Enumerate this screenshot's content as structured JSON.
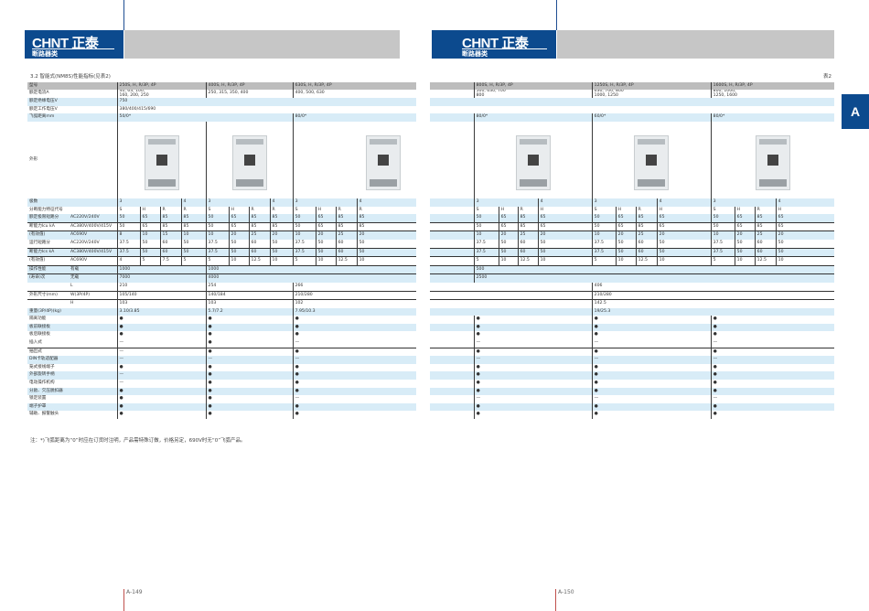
{
  "brand": {
    "logo": "CHNT 正泰",
    "category": "断路器类"
  },
  "section_title": "3.2 智能式(NM8S)性能指标(见表2)",
  "table_no": "表2",
  "side_tab": "A",
  "footnote": "注：*)飞弧距离为“0”时应在订货时注明，产品需特殊订做，价格另定，690V时无“0”飞弧产品。",
  "pages": {
    "left": "A-149",
    "right": "A-150"
  },
  "colors": {
    "brand_blue": "#0c4a8e",
    "row_blue": "#d8ecf7",
    "header_gray": "#bdbdbd"
  },
  "table": {
    "rows": [
      [
        "型号",
        "250S, H, R/3P, 4P",
        "400S, H, R/3P, 4P",
        "630S, H, R/3P, 4P",
        "800S, H, R/3P, 4P",
        "1250S, H, R/3P, 4P",
        "1600S, H, R/3P, 4P"
      ],
      [
        "额定电流A",
        "40, 63, 100,\n160, 200, 250",
        "250, 315, 350, 400",
        "400, 500, 630",
        "500, 630, 700\n800",
        "630, 700, 800\n1000, 1250",
        "800, 1000,\n1250, 1600"
      ],
      [
        "额定绝缘电压V",
        "750"
      ],
      [
        "额定工作电压V",
        "380/400/415/690"
      ],
      [
        "飞弧距离mm",
        "50/0*",
        "80/0*",
        "80/0*",
        "60/0*",
        "80/0*"
      ],
      [
        "外形"
      ],
      [
        "极数",
        "3",
        "4",
        "3",
        "4",
        "3",
        "4",
        "3",
        "4",
        "3",
        "4",
        "3",
        "4"
      ],
      [
        "分断能力特征代号",
        "S",
        "H",
        "R",
        "R",
        "S",
        "H",
        "R",
        "R",
        "S",
        "H",
        "R",
        "R",
        "S",
        "H",
        "R",
        "H",
        "S",
        "H",
        "R",
        "H",
        "S",
        "H",
        "R",
        "H"
      ],
      [
        "额定极限短路分",
        "AC220V/240V",
        "50",
        "65",
        "85",
        "85",
        "50",
        "65",
        "85",
        "85",
        "50",
        "65",
        "85",
        "85",
        "50",
        "65",
        "85",
        "65",
        "50",
        "65",
        "85",
        "65",
        "50",
        "65",
        "85",
        "65"
      ],
      [
        "断能力Icu kA",
        "AC380V/400V/415V",
        "50",
        "65",
        "85",
        "85",
        "50",
        "65",
        "85",
        "85",
        "50",
        "65",
        "85",
        "85",
        "50",
        "65",
        "85",
        "65",
        "50",
        "65",
        "85",
        "65",
        "50",
        "65",
        "85",
        "65"
      ],
      [
        "(有效值)",
        "AC690V",
        "8",
        "10",
        "15",
        "10",
        "10",
        "20",
        "25",
        "20",
        "10",
        "20",
        "25",
        "20",
        "10",
        "20",
        "25",
        "20",
        "10",
        "20",
        "25",
        "20",
        "10",
        "20",
        "25",
        "20"
      ],
      [
        "运行短路分",
        "AC220V/240V",
        "37.5",
        "50",
        "60",
        "50",
        "37.5",
        "50",
        "60",
        "50",
        "37.5",
        "50",
        "60",
        "50",
        "37.5",
        "50",
        "60",
        "50",
        "37.5",
        "50",
        "60",
        "50",
        "37.5",
        "50",
        "60",
        "50"
      ],
      [
        "断能力Ics kA",
        "AC380V/400V/415V",
        "37.5",
        "50",
        "60",
        "50",
        "37.5",
        "50",
        "60",
        "50",
        "37.5",
        "50",
        "60",
        "50",
        "37.5",
        "50",
        "60",
        "50",
        "37.5",
        "50",
        "60",
        "50",
        "37.5",
        "50",
        "60",
        "50"
      ],
      [
        "(有效值)",
        "AC690V",
        "4",
        "5",
        "7.5",
        "5",
        "5",
        "10",
        "12.5",
        "10",
        "5",
        "10",
        "12.5",
        "10",
        "5",
        "10",
        "12.5",
        "10",
        "5",
        "10",
        "12.5",
        "10",
        "5",
        "10",
        "12.5",
        "10"
      ],
      [
        "操作性能",
        "有载",
        "1000",
        "1000",
        "500"
      ],
      [
        "(寿命)次",
        "无载",
        "7000",
        "4000",
        "2500"
      ],
      [
        "",
        "L",
        "210",
        "254",
        "266",
        "406"
      ],
      [
        "外形尺寸(mm)",
        "W(3P/4P)",
        "105/140",
        "140/184",
        "210/280",
        "210/280"
      ],
      [
        "",
        "H",
        "103",
        "103",
        "102",
        "142.5"
      ],
      [
        "重量(3P/4P)(kg)",
        "3.10/3.85",
        "5.7/7.2",
        "7.95/10.3",
        "19/25.3"
      ],
      [
        "隔离功能",
        "●",
        "●",
        "●",
        "●",
        "●",
        "●"
      ],
      [
        "板前联接板",
        "●",
        "●",
        "●",
        "●",
        "●",
        "●"
      ],
      [
        "板后联接板",
        "●",
        "●",
        "●",
        "●",
        "●",
        "●"
      ],
      [
        "插入式",
        "—",
        "●",
        "—",
        "—",
        "—",
        "—"
      ],
      [
        "抽出式",
        "—",
        "●",
        "●",
        "●",
        "●",
        "●"
      ],
      [
        "DIN卡轨适配器",
        "—",
        "—",
        "—",
        "—",
        "—",
        "—"
      ],
      [
        "笼式接线端子",
        "●",
        "●",
        "●",
        "●",
        "●",
        "●"
      ],
      [
        "外部旋转手柄",
        "—",
        "●",
        "●",
        "●",
        "●",
        "●"
      ],
      [
        "电动操作机构",
        "—",
        "●",
        "●",
        "●",
        "●",
        "●"
      ],
      [
        "分励、欠压脱扣器",
        "●",
        "●",
        "●",
        "●",
        "●",
        "●"
      ],
      [
        "锁定装置",
        "●",
        "●",
        "—",
        "—",
        "—",
        "—"
      ],
      [
        "端子护罩",
        "●",
        "●",
        "●",
        "●",
        "●",
        "●"
      ],
      [
        "辅助、报警触头",
        "●",
        "●",
        "●",
        "●",
        "●",
        "●"
      ]
    ]
  }
}
